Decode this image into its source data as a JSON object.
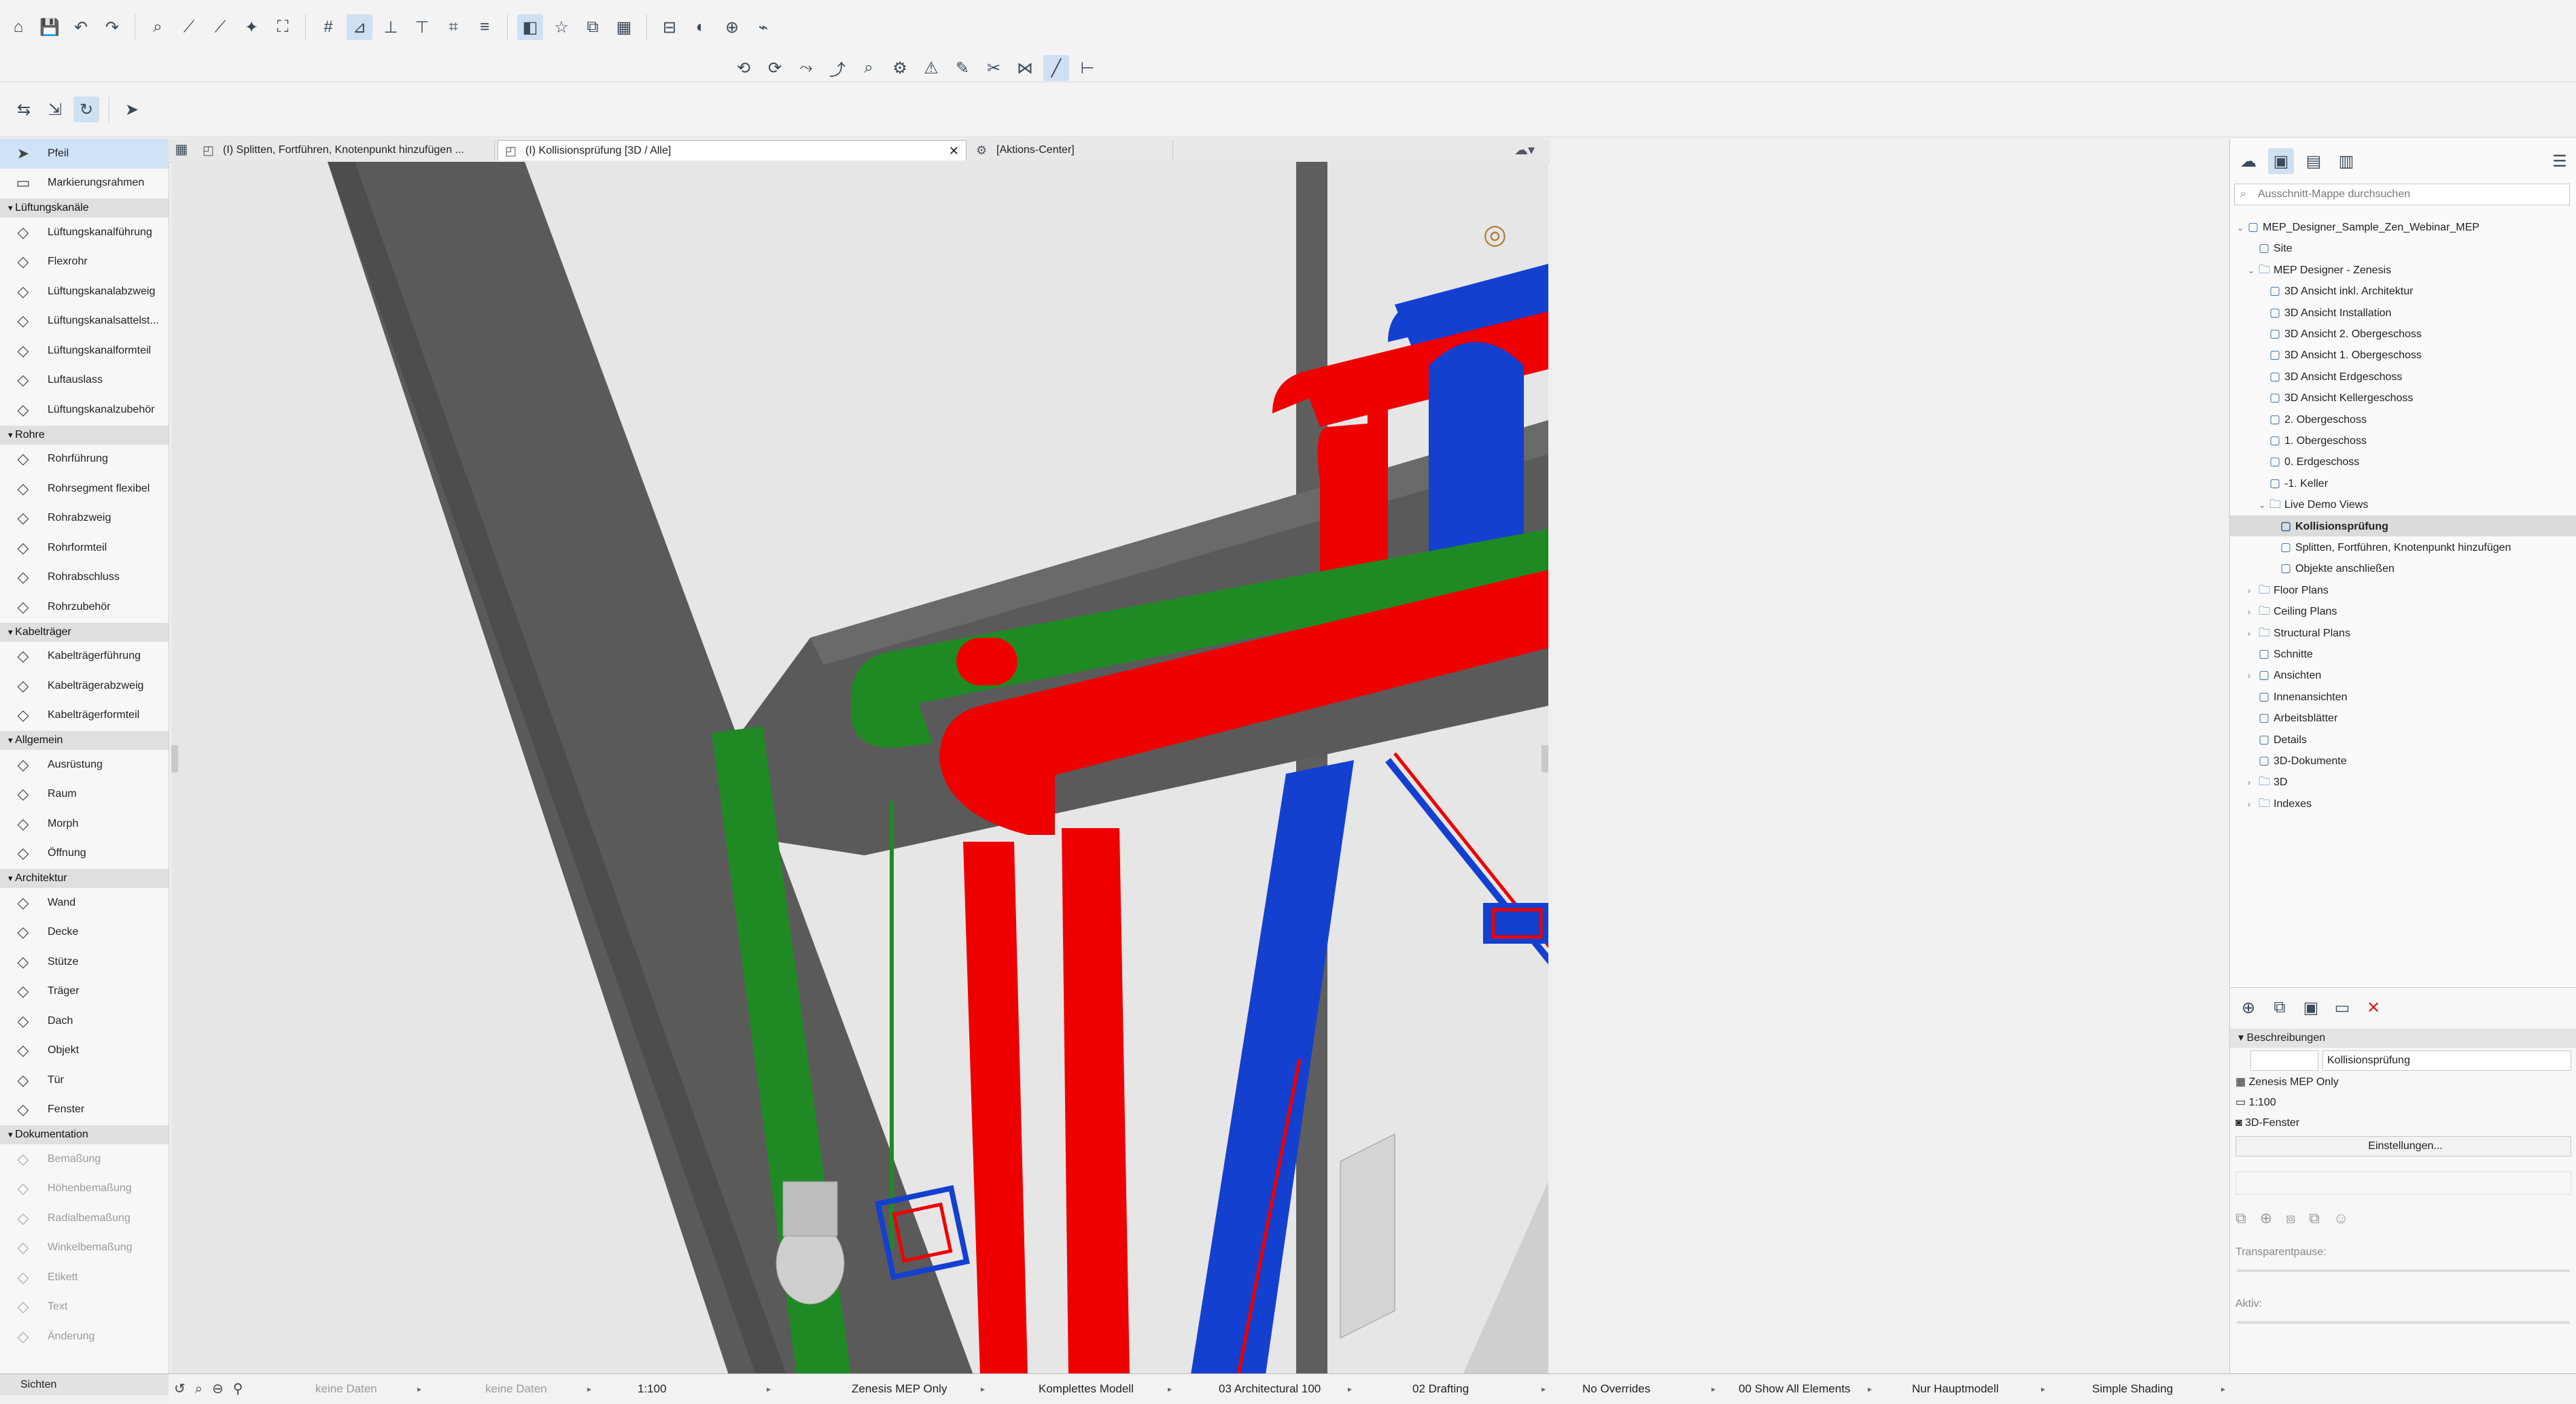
{
  "colors": {
    "duct_red": "#ee0000",
    "duct_blue": "#1440d0",
    "duct_green": "#1f8a23",
    "beam_grey": "#585858",
    "selection_blue": "#cfe3f7",
    "error_red": "#d32020"
  },
  "toolbar": {
    "row1_icons": [
      "home-icon",
      "save-icon",
      "undo-icon",
      "redo-icon",
      "find-select-icon",
      "pick-up-icon",
      "inject-icon",
      "magic-wand-icon",
      "fit-in-window-icon",
      "grid-icon",
      "tracker-icon",
      "guide-line-icon",
      "gravity-icon",
      "snap-grid-icon",
      "layers-icon",
      "renovation-icon",
      "favorites-icon",
      "model-view-icon",
      "floor-plan-icon",
      "section-icon",
      "render-icon",
      "teamwork-icon",
      "trace-icon"
    ],
    "row2_icons": [
      "mep-route-icon",
      "mep-branch-icon",
      "connect-icon",
      "disconnect-icon",
      "check-connection-icon",
      "mep-preferences-icon",
      "collision-icon",
      "edit-route-icon",
      "split-icon",
      "merge-icon",
      "draw-line-icon",
      "dimension-icon"
    ]
  },
  "toolbox": {
    "sections": [
      {
        "title": "",
        "items": [
          {
            "label": "Pfeil",
            "icon": "arrow-icon",
            "active": true,
            "enabled": true
          },
          {
            "label": "Markierungsrahmen",
            "icon": "marquee-icon",
            "active": false,
            "enabled": true
          }
        ]
      },
      {
        "title": "Lüftungskanäle",
        "items": [
          {
            "label": "Lüftungskanalführung",
            "icon": "duct-routing-icon",
            "enabled": true
          },
          {
            "label": "Flexrohr",
            "icon": "flex-duct-icon",
            "enabled": true
          },
          {
            "label": "Lüftungskanalabzweig",
            "icon": "duct-branch-icon",
            "enabled": true
          },
          {
            "label": "Lüftungskanalsattelst...",
            "icon": "duct-takeoff-icon",
            "enabled": true
          },
          {
            "label": "Lüftungskanalformteil",
            "icon": "duct-fitting-icon",
            "enabled": true
          },
          {
            "label": "Luftauslass",
            "icon": "air-terminal-icon",
            "enabled": true
          },
          {
            "label": "Lüftungskanalzubehör",
            "icon": "duct-accessory-icon",
            "enabled": true
          }
        ]
      },
      {
        "title": "Rohre",
        "items": [
          {
            "label": "Rohrführung",
            "icon": "pipe-routing-icon",
            "enabled": true
          },
          {
            "label": "Rohrsegment flexibel",
            "icon": "flex-pipe-icon",
            "enabled": true
          },
          {
            "label": "Rohrabzweig",
            "icon": "pipe-branch-icon",
            "enabled": true
          },
          {
            "label": "Rohrformteil",
            "icon": "pipe-fitting-icon",
            "enabled": true
          },
          {
            "label": "Rohrabschluss",
            "icon": "pipe-terminal-icon",
            "enabled": true
          },
          {
            "label": "Rohrzubehör",
            "icon": "pipe-accessory-icon",
            "enabled": true
          }
        ]
      },
      {
        "title": "Kabelträger",
        "items": [
          {
            "label": "Kabelträgerführung",
            "icon": "cable-carrier-routing-icon",
            "enabled": true
          },
          {
            "label": "Kabelträgerabzweig",
            "icon": "cable-carrier-branch-icon",
            "enabled": true
          },
          {
            "label": "Kabelträgerformteil",
            "icon": "cable-carrier-fitting-icon",
            "enabled": true
          }
        ]
      },
      {
        "title": "Allgemein",
        "items": [
          {
            "label": "Ausrüstung",
            "icon": "equipment-icon",
            "enabled": true
          },
          {
            "label": "Raum",
            "icon": "zone-icon",
            "enabled": true
          },
          {
            "label": "Morph",
            "icon": "morph-icon",
            "enabled": true
          },
          {
            "label": "Öffnung",
            "icon": "opening-icon",
            "enabled": true
          }
        ]
      },
      {
        "title": "Architektur",
        "items": [
          {
            "label": "Wand",
            "icon": "wall-icon",
            "enabled": true
          },
          {
            "label": "Decke",
            "icon": "slab-icon",
            "enabled": true
          },
          {
            "label": "Stütze",
            "icon": "column-icon",
            "enabled": true
          },
          {
            "label": "Träger",
            "icon": "beam-icon",
            "enabled": true
          },
          {
            "label": "Dach",
            "icon": "roof-icon",
            "enabled": true
          },
          {
            "label": "Objekt",
            "icon": "object-icon",
            "enabled": true
          },
          {
            "label": "Tür",
            "icon": "door-icon",
            "enabled": true
          },
          {
            "label": "Fenster",
            "icon": "window-icon",
            "enabled": true
          }
        ]
      },
      {
        "title": "Dokumentation",
        "items": [
          {
            "label": "Bemaßung",
            "icon": "dimension-icon",
            "enabled": false
          },
          {
            "label": "Höhenbemaßung",
            "icon": "level-dimension-icon",
            "enabled": false
          },
          {
            "label": "Radialbemaßung",
            "icon": "radial-dimension-icon",
            "enabled": false
          },
          {
            "label": "Winkelbemaßung",
            "icon": "angle-dimension-icon",
            "enabled": false
          },
          {
            "label": "Etikett",
            "icon": "label-icon",
            "enabled": false
          },
          {
            "label": "Text",
            "icon": "text-icon",
            "enabled": false
          },
          {
            "label": "Änderung",
            "icon": "change-icon",
            "enabled": false
          }
        ]
      }
    ],
    "bottom_tab": "Sichten"
  },
  "tabs": [
    {
      "label": "(I) Splitten, Fortführen, Knotenpunkt hinzufügen ...",
      "icon": "3d-window-icon",
      "active": false
    },
    {
      "label": "(I) Kollisionsprüfung [3D / Alle]",
      "icon": "3d-window-icon",
      "active": true
    },
    {
      "label": "[Aktions-Center]",
      "icon": "action-center-icon",
      "active": false
    }
  ],
  "statusbar": {
    "items": [
      {
        "label": "keine Daten",
        "dim": true
      },
      {
        "label": "keine Daten",
        "dim": true
      },
      {
        "label": "1:100",
        "dim": false
      },
      {
        "label": "Zenesis MEP Only",
        "dim": false
      },
      {
        "label": "Komplettes Modell",
        "dim": false
      },
      {
        "label": "03 Architectural 100",
        "dim": false
      },
      {
        "label": "02 Drafting",
        "dim": false
      },
      {
        "label": "No Overrides",
        "dim": false
      },
      {
        "label": "00 Show All Elements",
        "dim": false
      },
      {
        "label": "Nur Hauptmodell",
        "dim": false
      },
      {
        "label": "Simple Shading",
        "dim": false
      }
    ]
  },
  "navigator": {
    "search_placeholder": "Ausschnitt-Mappe durchsuchen",
    "tree": [
      {
        "label": "MEP_Designer_Sample_Zen_Webinar_MEP",
        "level": 0,
        "twisty": "v",
        "icon": "project-icon"
      },
      {
        "label": "Site",
        "level": 1,
        "twisty": "",
        "icon": "story-icon"
      },
      {
        "label": "MEP Designer - Zenesis",
        "level": 1,
        "twisty": "v",
        "icon": "folder-icon"
      },
      {
        "label": "3D Ansicht inkl. Architektur",
        "level": 2,
        "twisty": "",
        "icon": "3d-view-icon"
      },
      {
        "label": "3D Ansicht Installation",
        "level": 2,
        "twisty": "",
        "icon": "3d-view-icon"
      },
      {
        "label": "3D Ansicht 2. Obergeschoss",
        "level": 2,
        "twisty": "",
        "icon": "3d-view-icon"
      },
      {
        "label": "3D Ansicht 1. Obergeschoss",
        "level": 2,
        "twisty": "",
        "icon": "3d-view-icon"
      },
      {
        "label": "3D Ansicht Erdgeschoss",
        "level": 2,
        "twisty": "",
        "icon": "3d-view-icon"
      },
      {
        "label": "3D Ansicht Kellergeschoss",
        "level": 2,
        "twisty": "",
        "icon": "3d-view-icon"
      },
      {
        "label": "2. Obergeschoss",
        "level": 2,
        "twisty": "",
        "icon": "story-icon"
      },
      {
        "label": "1. Obergeschoss",
        "level": 2,
        "twisty": "",
        "icon": "story-icon"
      },
      {
        "label": "0. Erdgeschoss",
        "level": 2,
        "twisty": "",
        "icon": "story-icon"
      },
      {
        "label": "-1. Keller",
        "level": 2,
        "twisty": "",
        "icon": "story-icon"
      },
      {
        "label": "Live Demo Views",
        "level": 2,
        "twisty": "v",
        "icon": "folder-icon"
      },
      {
        "label": "Kollisionsprüfung",
        "level": 3,
        "twisty": "",
        "icon": "3d-view-icon",
        "selected": true
      },
      {
        "label": "Splitten, Fortführen, Knotenpunkt hinzufügen",
        "level": 3,
        "twisty": "",
        "icon": "3d-view-icon"
      },
      {
        "label": "Objekte anschließen",
        "level": 3,
        "twisty": "",
        "icon": "3d-view-icon"
      },
      {
        "label": "Floor Plans",
        "level": 1,
        "twisty": ">",
        "icon": "folder-icon"
      },
      {
        "label": "Ceiling Plans",
        "level": 1,
        "twisty": ">",
        "icon": "folder-icon"
      },
      {
        "label": "Structural Plans",
        "level": 1,
        "twisty": ">",
        "icon": "folder-icon"
      },
      {
        "label": "Schnitte",
        "level": 1,
        "twisty": "",
        "icon": "section-icon"
      },
      {
        "label": "Ansichten",
        "level": 1,
        "twisty": ">",
        "icon": "elevation-icon"
      },
      {
        "label": "Innenansichten",
        "level": 1,
        "twisty": "",
        "icon": "interior-elevation-icon"
      },
      {
        "label": "Arbeitsblätter",
        "level": 1,
        "twisty": "",
        "icon": "worksheet-icon"
      },
      {
        "label": "Details",
        "level": 1,
        "twisty": "",
        "icon": "detail-icon"
      },
      {
        "label": "3D-Dokumente",
        "level": 1,
        "twisty": "",
        "icon": "3d-document-icon"
      },
      {
        "label": "3D",
        "level": 1,
        "twisty": ">",
        "icon": "folder-icon"
      },
      {
        "label": "Indexes",
        "level": 1,
        "twisty": ">",
        "icon": "folder-icon"
      }
    ]
  },
  "info": {
    "section_title": "Beschreibungen",
    "name_value": "Kollisionsprüfung",
    "view_map_value": "Zenesis MEP Only",
    "scale_value": "1:100",
    "window_value": "3D-Fenster",
    "settings_button": "Einstellungen...",
    "transparent_label": "Transparentpause:",
    "active_label": "Aktiv:"
  }
}
